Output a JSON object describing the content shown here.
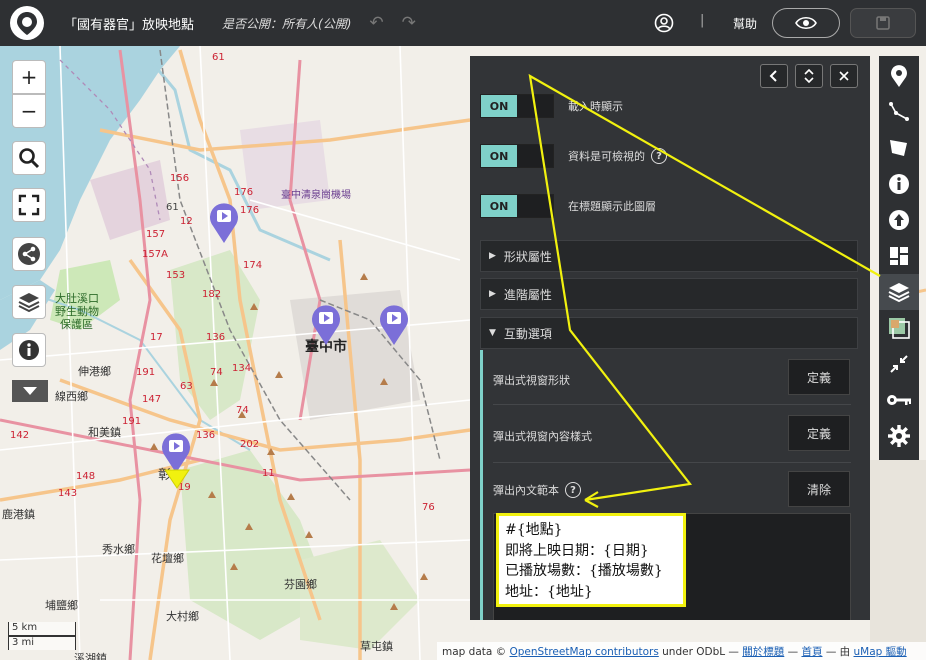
{
  "header": {
    "map_title": "「國有器官」放映地點",
    "share_status": "是否公開：所有人(公開)",
    "help": "幫助"
  },
  "map": {
    "places": [
      "臺中清泉崗機場",
      "大肚溪口",
      "野生動物",
      "保護區",
      "伸港鄉",
      "線西鄉",
      "和美鎮",
      "鹿港鎮",
      "秀水鄉",
      "花壇鄉",
      "埔鹽鄉",
      "大村鄉",
      "芬園鄉",
      "草屯鎮",
      "溪湖鎮",
      "臺中市",
      "彰"
    ],
    "road_numbers": [
      "61",
      "176",
      "156",
      "61",
      "157",
      "176",
      "12",
      "174",
      "153",
      "157A",
      "182",
      "17",
      "136",
      "134",
      "74",
      "191",
      "63",
      "74",
      "147",
      "142",
      "191",
      "148",
      "19",
      "11",
      "202",
      "136",
      "143",
      "76"
    ],
    "scale_km": "5 km",
    "scale_mi": "3 mi"
  },
  "attribution": {
    "prefix": "map data ©",
    "osm_link": "OpenStreetMap contributors",
    "middle": "under ODbL —",
    "about": "關於標題",
    "dash1": "—",
    "home": "首頁",
    "dash2": "— 由",
    "umap": "uMap 驅動"
  },
  "panel": {
    "toggles": [
      {
        "state": "ON",
        "label": "載入時顯示"
      },
      {
        "state": "ON",
        "label": "資料是可檢視的"
      },
      {
        "state": "ON",
        "label": "在標題顯示此圖層"
      }
    ],
    "sections": {
      "shape": "形狀屬性",
      "advanced": "進階屬性",
      "interaction": "互動選項"
    },
    "options": [
      {
        "label": "彈出式視窗形狀",
        "button": "定義"
      },
      {
        "label": "彈出式視窗內容樣式",
        "button": "定義"
      },
      {
        "label": "彈出內文範本",
        "button": "清除"
      }
    ],
    "template_lines": [
      "#{地點}",
      "即將上映日期：{日期}",
      "已播放場數：{播放場數}",
      "地址：{地址}"
    ]
  },
  "colors": {
    "topbar": "#2e3033",
    "panel": "#323437",
    "toggle_on": "#7fd1c9",
    "marker": "#7b6fd8",
    "annotation": "#f1f10f"
  }
}
